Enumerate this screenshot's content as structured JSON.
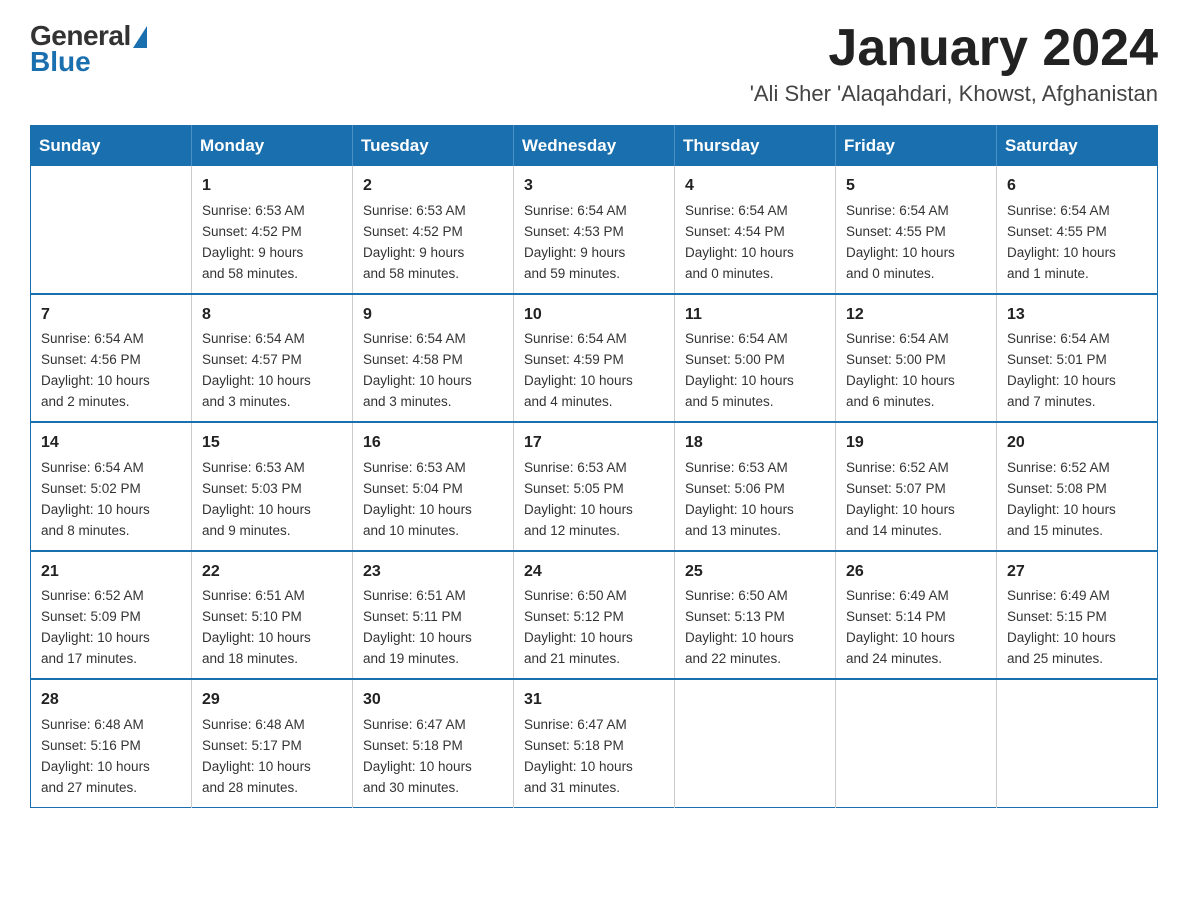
{
  "header": {
    "logo_general": "General",
    "logo_blue": "Blue",
    "month_title": "January 2024",
    "location": "'Ali Sher 'Alaqahdari, Khowst, Afghanistan"
  },
  "days_of_week": [
    "Sunday",
    "Monday",
    "Tuesday",
    "Wednesday",
    "Thursday",
    "Friday",
    "Saturday"
  ],
  "weeks": [
    [
      {
        "day": "",
        "info": ""
      },
      {
        "day": "1",
        "info": "Sunrise: 6:53 AM\nSunset: 4:52 PM\nDaylight: 9 hours\nand 58 minutes."
      },
      {
        "day": "2",
        "info": "Sunrise: 6:53 AM\nSunset: 4:52 PM\nDaylight: 9 hours\nand 58 minutes."
      },
      {
        "day": "3",
        "info": "Sunrise: 6:54 AM\nSunset: 4:53 PM\nDaylight: 9 hours\nand 59 minutes."
      },
      {
        "day": "4",
        "info": "Sunrise: 6:54 AM\nSunset: 4:54 PM\nDaylight: 10 hours\nand 0 minutes."
      },
      {
        "day": "5",
        "info": "Sunrise: 6:54 AM\nSunset: 4:55 PM\nDaylight: 10 hours\nand 0 minutes."
      },
      {
        "day": "6",
        "info": "Sunrise: 6:54 AM\nSunset: 4:55 PM\nDaylight: 10 hours\nand 1 minute."
      }
    ],
    [
      {
        "day": "7",
        "info": "Sunrise: 6:54 AM\nSunset: 4:56 PM\nDaylight: 10 hours\nand 2 minutes."
      },
      {
        "day": "8",
        "info": "Sunrise: 6:54 AM\nSunset: 4:57 PM\nDaylight: 10 hours\nand 3 minutes."
      },
      {
        "day": "9",
        "info": "Sunrise: 6:54 AM\nSunset: 4:58 PM\nDaylight: 10 hours\nand 3 minutes."
      },
      {
        "day": "10",
        "info": "Sunrise: 6:54 AM\nSunset: 4:59 PM\nDaylight: 10 hours\nand 4 minutes."
      },
      {
        "day": "11",
        "info": "Sunrise: 6:54 AM\nSunset: 5:00 PM\nDaylight: 10 hours\nand 5 minutes."
      },
      {
        "day": "12",
        "info": "Sunrise: 6:54 AM\nSunset: 5:00 PM\nDaylight: 10 hours\nand 6 minutes."
      },
      {
        "day": "13",
        "info": "Sunrise: 6:54 AM\nSunset: 5:01 PM\nDaylight: 10 hours\nand 7 minutes."
      }
    ],
    [
      {
        "day": "14",
        "info": "Sunrise: 6:54 AM\nSunset: 5:02 PM\nDaylight: 10 hours\nand 8 minutes."
      },
      {
        "day": "15",
        "info": "Sunrise: 6:53 AM\nSunset: 5:03 PM\nDaylight: 10 hours\nand 9 minutes."
      },
      {
        "day": "16",
        "info": "Sunrise: 6:53 AM\nSunset: 5:04 PM\nDaylight: 10 hours\nand 10 minutes."
      },
      {
        "day": "17",
        "info": "Sunrise: 6:53 AM\nSunset: 5:05 PM\nDaylight: 10 hours\nand 12 minutes."
      },
      {
        "day": "18",
        "info": "Sunrise: 6:53 AM\nSunset: 5:06 PM\nDaylight: 10 hours\nand 13 minutes."
      },
      {
        "day": "19",
        "info": "Sunrise: 6:52 AM\nSunset: 5:07 PM\nDaylight: 10 hours\nand 14 minutes."
      },
      {
        "day": "20",
        "info": "Sunrise: 6:52 AM\nSunset: 5:08 PM\nDaylight: 10 hours\nand 15 minutes."
      }
    ],
    [
      {
        "day": "21",
        "info": "Sunrise: 6:52 AM\nSunset: 5:09 PM\nDaylight: 10 hours\nand 17 minutes."
      },
      {
        "day": "22",
        "info": "Sunrise: 6:51 AM\nSunset: 5:10 PM\nDaylight: 10 hours\nand 18 minutes."
      },
      {
        "day": "23",
        "info": "Sunrise: 6:51 AM\nSunset: 5:11 PM\nDaylight: 10 hours\nand 19 minutes."
      },
      {
        "day": "24",
        "info": "Sunrise: 6:50 AM\nSunset: 5:12 PM\nDaylight: 10 hours\nand 21 minutes."
      },
      {
        "day": "25",
        "info": "Sunrise: 6:50 AM\nSunset: 5:13 PM\nDaylight: 10 hours\nand 22 minutes."
      },
      {
        "day": "26",
        "info": "Sunrise: 6:49 AM\nSunset: 5:14 PM\nDaylight: 10 hours\nand 24 minutes."
      },
      {
        "day": "27",
        "info": "Sunrise: 6:49 AM\nSunset: 5:15 PM\nDaylight: 10 hours\nand 25 minutes."
      }
    ],
    [
      {
        "day": "28",
        "info": "Sunrise: 6:48 AM\nSunset: 5:16 PM\nDaylight: 10 hours\nand 27 minutes."
      },
      {
        "day": "29",
        "info": "Sunrise: 6:48 AM\nSunset: 5:17 PM\nDaylight: 10 hours\nand 28 minutes."
      },
      {
        "day": "30",
        "info": "Sunrise: 6:47 AM\nSunset: 5:18 PM\nDaylight: 10 hours\nand 30 minutes."
      },
      {
        "day": "31",
        "info": "Sunrise: 6:47 AM\nSunset: 5:18 PM\nDaylight: 10 hours\nand 31 minutes."
      },
      {
        "day": "",
        "info": ""
      },
      {
        "day": "",
        "info": ""
      },
      {
        "day": "",
        "info": ""
      }
    ]
  ]
}
